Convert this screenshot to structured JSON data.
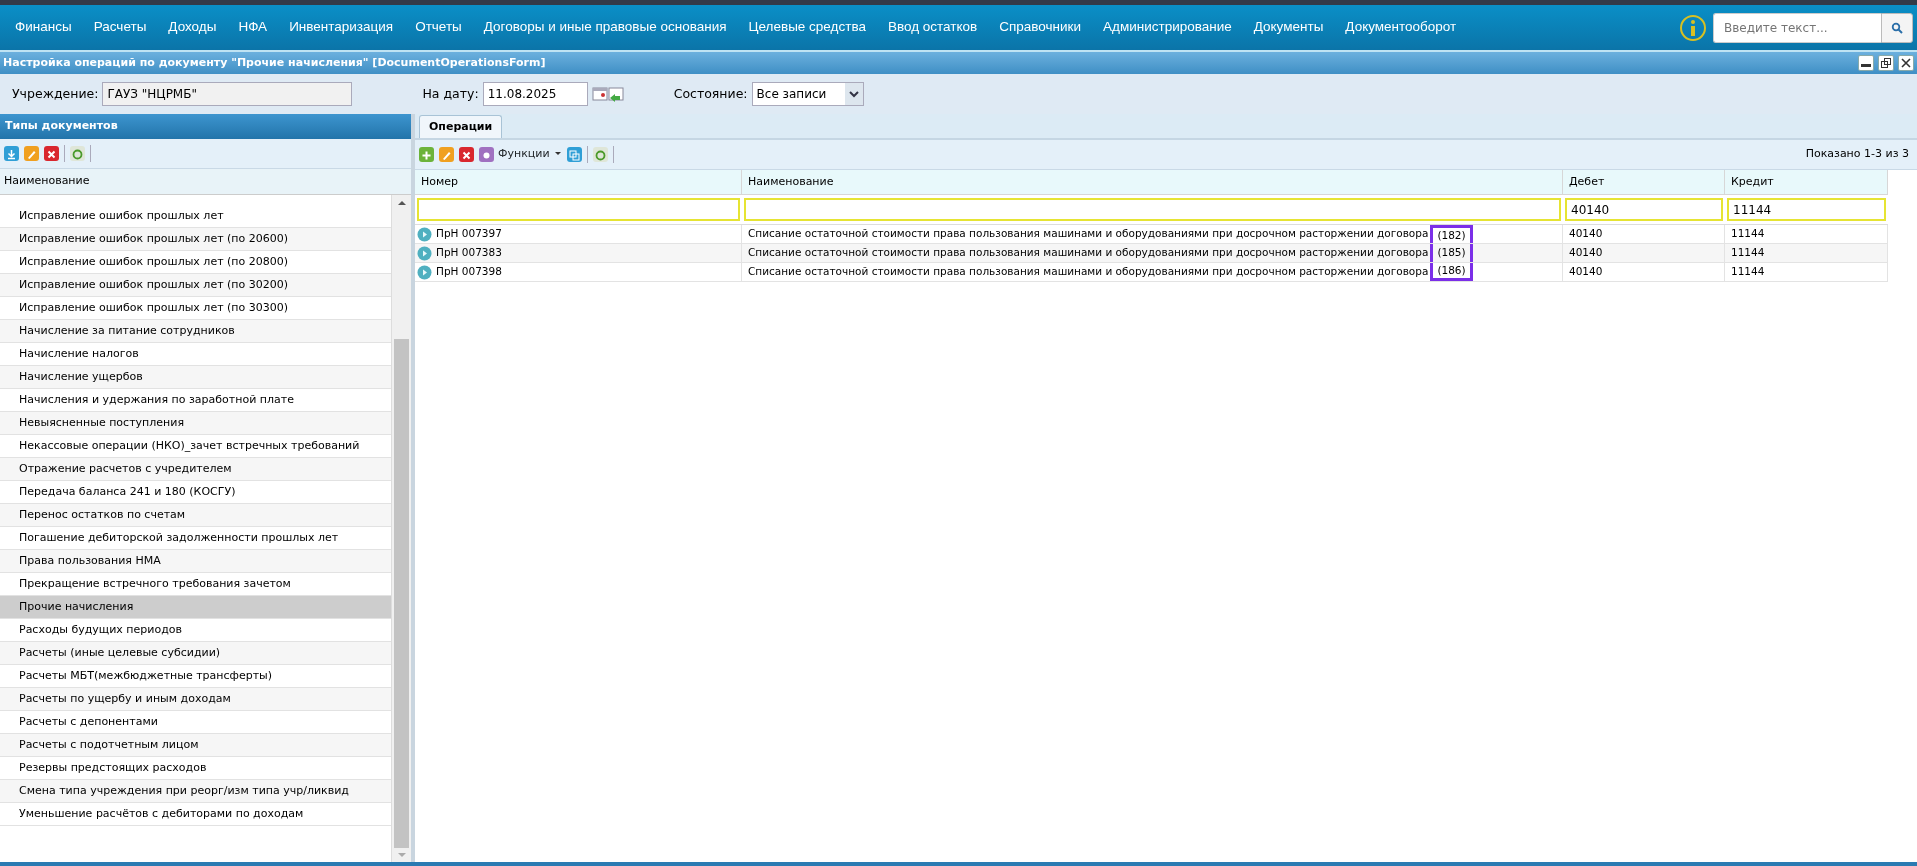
{
  "menu": [
    "Финансы",
    "Расчеты",
    "Доходы",
    "НФА",
    "Инвентаризация",
    "Отчеты",
    "Договоры и иные правовые основания",
    "Целевые средства",
    "Ввод остатков",
    "Справочники",
    "Администрирование",
    "Документы",
    "Документооборот"
  ],
  "search": {
    "placeholder": "Введите текст..."
  },
  "window": {
    "title": "Настройка операций по документу \"Прочие начисления\" [DocumentOperationsForm]"
  },
  "form": {
    "institution_label": "Учреждение:",
    "institution": "ГАУЗ \"НЦРМБ\"",
    "date_label": "На дату:",
    "date": "11.08.2025",
    "state_label": "Состояние:",
    "state": "Все записи"
  },
  "left_panel": {
    "title": "Типы документов",
    "column": "Наименование",
    "items": [
      {
        "label": "Исправление ошибок прошлых лет",
        "selected": false
      },
      {
        "label": "Исправление ошибок прошлых лет (по 20600)",
        "selected": false
      },
      {
        "label": "Исправление ошибок прошлых лет (по 20800)",
        "selected": false
      },
      {
        "label": "Исправление ошибок прошлых лет (по 30200)",
        "selected": false
      },
      {
        "label": "Исправление ошибок прошлых лет (по 30300)",
        "selected": false
      },
      {
        "label": "Начисление за питание сотрудников",
        "selected": false
      },
      {
        "label": "Начисление налогов",
        "selected": false
      },
      {
        "label": "Начисление ущербов",
        "selected": false
      },
      {
        "label": "Начисления и удержания по заработной плате",
        "selected": false
      },
      {
        "label": "Невыясненные поступления",
        "selected": false
      },
      {
        "label": "Некассовые операции (НКО)_зачет встречных требований",
        "selected": false
      },
      {
        "label": "Отражение расчетов с учредителем",
        "selected": false
      },
      {
        "label": "Передача баланса 241 и 180 (КОСГУ)",
        "selected": false
      },
      {
        "label": "Перенос остатков по счетам",
        "selected": false
      },
      {
        "label": "Погашение дебиторской задолженности прошлых лет",
        "selected": false
      },
      {
        "label": "Права пользования НМА",
        "selected": false
      },
      {
        "label": "Прекращение встречного требования зачетом",
        "selected": false
      },
      {
        "label": "Прочие начисления",
        "selected": true
      },
      {
        "label": "Расходы будущих периодов",
        "selected": false
      },
      {
        "label": "Расчеты (иные целевые субсидии)",
        "selected": false
      },
      {
        "label": "Расчеты МБТ(межбюджетные трансферты)",
        "selected": false
      },
      {
        "label": "Расчеты по ущербу и иным доходам",
        "selected": false
      },
      {
        "label": "Расчеты с депонентами",
        "selected": false
      },
      {
        "label": "Расчеты с подотчетным лицом",
        "selected": false
      },
      {
        "label": "Резервы предстоящих расходов",
        "selected": false
      },
      {
        "label": "Смена типа учреждения при реорг/изм типа учр/ликвид",
        "selected": false
      },
      {
        "label": "Уменьшение расчётов с дебиторами по доходам",
        "selected": false
      }
    ]
  },
  "tabs": [
    {
      "label": "Операции",
      "selected": true
    }
  ],
  "toolbar": {
    "functions": "Функции",
    "shown": "Показано 1-3 из 3"
  },
  "table": {
    "columns": [
      "Номер",
      "Наименование",
      "Дебет",
      "Кредит"
    ],
    "filters": {
      "debit": "40140",
      "credit": "11144"
    },
    "rows": [
      {
        "number": "ПрН 007397",
        "name": "Списание остаточной стоимости права пользования машинами и оборудованиями при досрочном расторжении договора",
        "note": "(182)",
        "debit": "40140",
        "credit": "11144"
      },
      {
        "number": "ПрН 007383",
        "name": "Списание остаточной стоимости права пользования машинами и оборудованиями при досрочном расторжении договора",
        "note": "(185)",
        "debit": "40140",
        "credit": "11144"
      },
      {
        "number": "ПрН 007398",
        "name": "Списание остаточной стоимости права пользования машинами и оборудованиями при досрочном расторжении договора",
        "note": "(186)",
        "debit": "40140",
        "credit": "11144"
      }
    ]
  }
}
